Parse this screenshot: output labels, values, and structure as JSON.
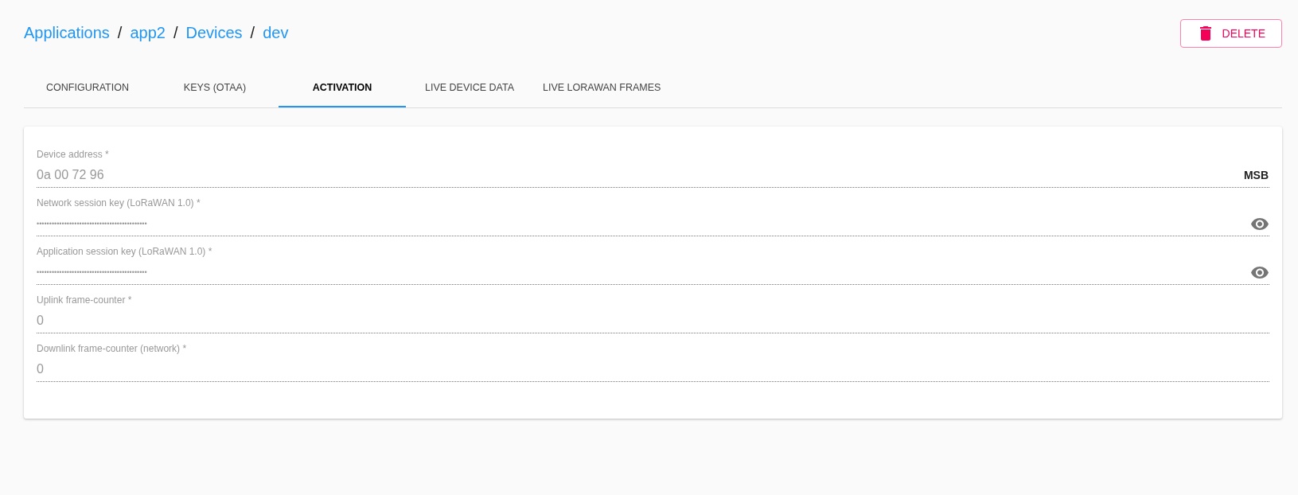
{
  "breadcrumb": [
    {
      "label": "Applications"
    },
    {
      "label": "app2"
    },
    {
      "label": "Devices"
    },
    {
      "label": "dev"
    }
  ],
  "breadcrumb_separator": "/",
  "delete_button": {
    "label": "DELETE"
  },
  "tabs": [
    {
      "label": "CONFIGURATION",
      "selected": false
    },
    {
      "label": "KEYS (OTAA)",
      "selected": false
    },
    {
      "label": "ACTIVATION",
      "selected": true
    },
    {
      "label": "LIVE DEVICE DATA",
      "selected": false
    },
    {
      "label": "LIVE LORAWAN FRAMES",
      "selected": false
    }
  ],
  "fields": [
    {
      "kind": "text",
      "label": "Device address *",
      "value": "0a 00 72 96",
      "suffix": "MSB"
    },
    {
      "kind": "password",
      "label": "Network session key (LoRaWAN 1.0) *",
      "value": "••••••••••••••••••••••••••••••••••••••••••••"
    },
    {
      "kind": "password",
      "label": "Application session key (LoRaWAN 1.0) *",
      "value": "••••••••••••••••••••••••••••••••••••••••••••"
    },
    {
      "kind": "text",
      "label": "Uplink frame-counter *",
      "value": "0"
    },
    {
      "kind": "text",
      "label": "Downlink frame-counter (network) *",
      "value": "0"
    }
  ]
}
